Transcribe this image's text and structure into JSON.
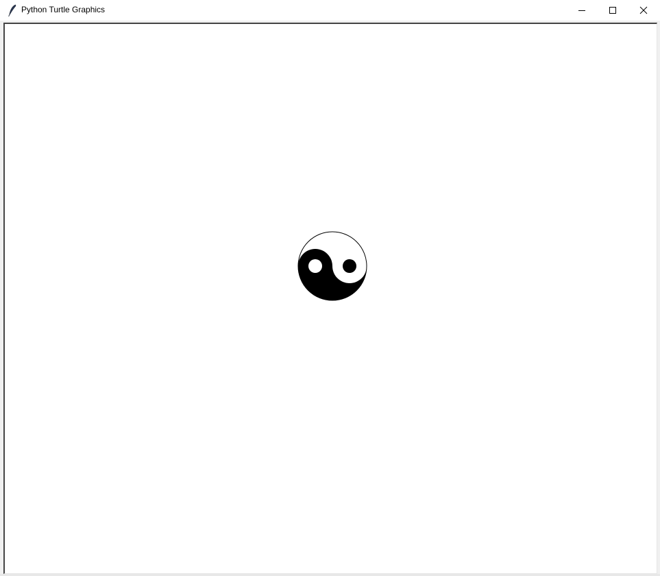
{
  "window": {
    "title": "Python Turtle Graphics",
    "app_icon": "feather-icon",
    "controls": {
      "minimize_icon": "minimize-icon",
      "maximize_icon": "maximize-icon",
      "close_icon": "close-icon"
    }
  },
  "canvas": {
    "background": "#ffffff",
    "drawing": {
      "type": "yin-yang",
      "colors": {
        "dark": "#000000",
        "light": "#ffffff"
      }
    }
  }
}
